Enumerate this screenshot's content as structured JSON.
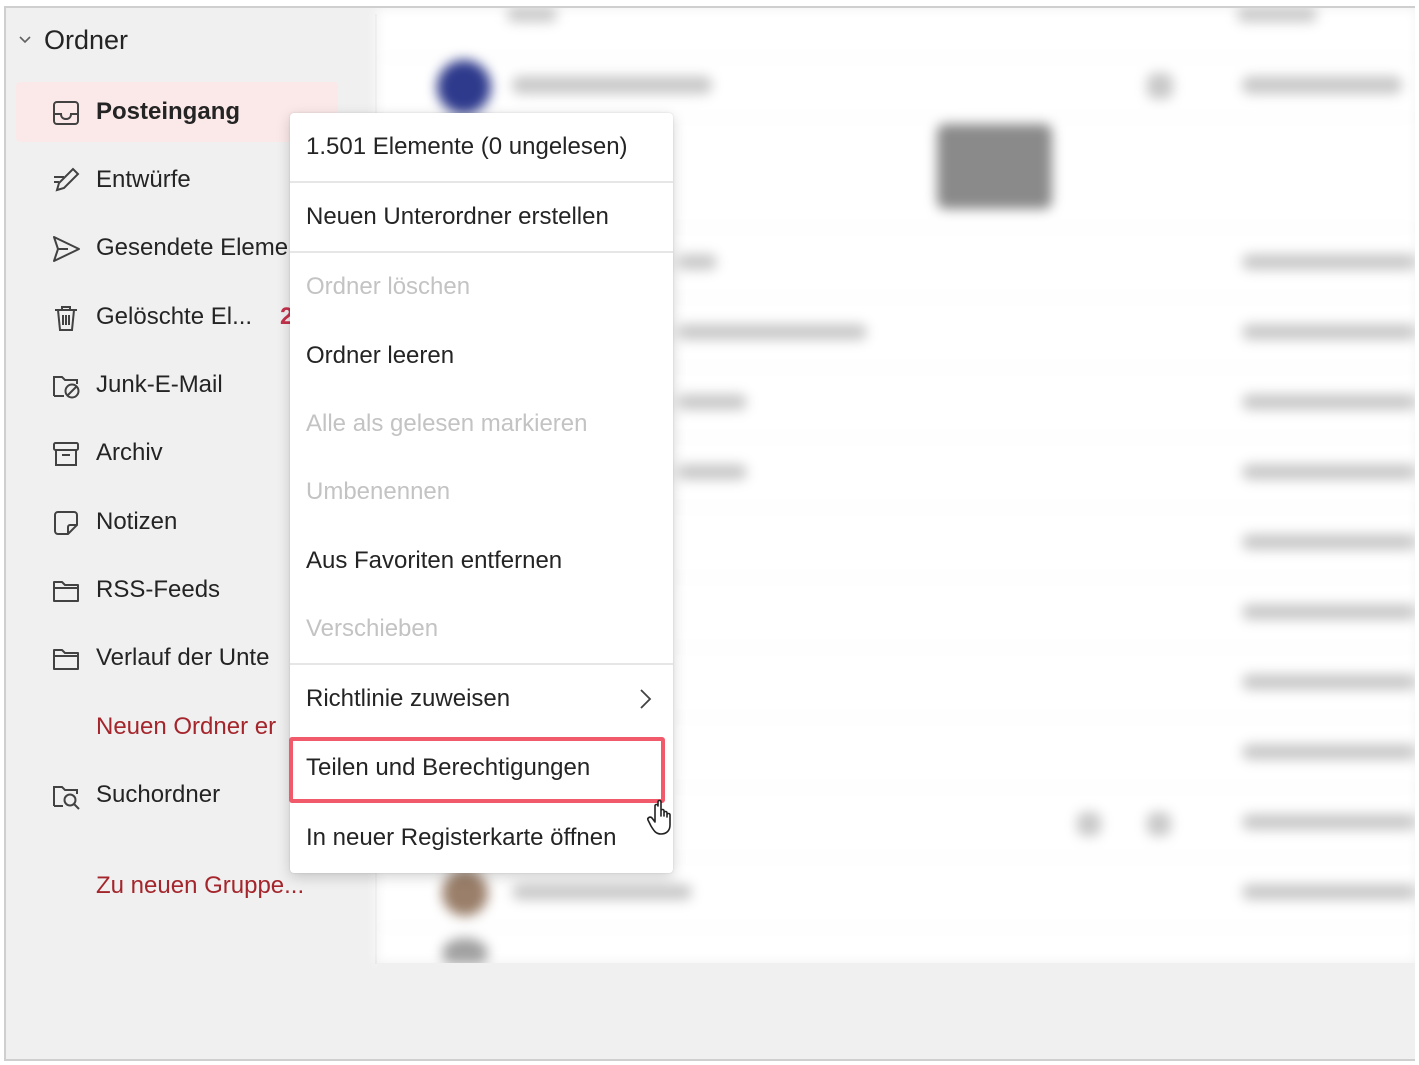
{
  "sidebar": {
    "header": "Ordner",
    "items": [
      {
        "label": "Posteingang",
        "icon": "inbox-icon"
      },
      {
        "label": "Entwürfe",
        "icon": "pencil-icon"
      },
      {
        "label": "Gesendete Eleme",
        "icon": "send-icon"
      },
      {
        "label": "Gelöschte El...",
        "icon": "trash-icon",
        "badge": "2"
      },
      {
        "label": "Junk-E-Mail",
        "icon": "junk-icon"
      },
      {
        "label": "Archiv",
        "icon": "archive-icon"
      },
      {
        "label": "Notizen",
        "icon": "note-icon"
      },
      {
        "label": "RSS-Feeds",
        "icon": "folder-icon"
      },
      {
        "label": "Verlauf der Unte",
        "icon": "folder-icon"
      },
      {
        "label": "Neuen Ordner er"
      },
      {
        "label": "Suchordner",
        "icon": "search-folder-icon"
      },
      {
        "label": "Zu neuen Gruppe..."
      }
    ]
  },
  "context_menu": {
    "info": "1.501 Elemente (0 ungelesen)",
    "items": [
      {
        "label": "Neuen Unterordner erstellen",
        "enabled": true
      },
      {
        "label": "Ordner löschen",
        "enabled": false
      },
      {
        "label": "Ordner leeren",
        "enabled": true
      },
      {
        "label": "Alle als gelesen markieren",
        "enabled": false
      },
      {
        "label": "Umbenennen",
        "enabled": false
      },
      {
        "label": "Aus Favoriten entfernen",
        "enabled": true
      },
      {
        "label": "Verschieben",
        "enabled": false
      },
      {
        "label": "Richtlinie zuweisen",
        "enabled": true,
        "submenu": true
      },
      {
        "label": "Teilen und Berechtigungen",
        "enabled": true,
        "highlighted": true
      },
      {
        "label": "In neuer Registerkarte öffnen",
        "enabled": true
      }
    ]
  },
  "colors": {
    "accent": "#a4262c",
    "selected_bg": "#fbe9e9",
    "highlight_border": "#f05a6b",
    "badge": "#c4314b"
  }
}
